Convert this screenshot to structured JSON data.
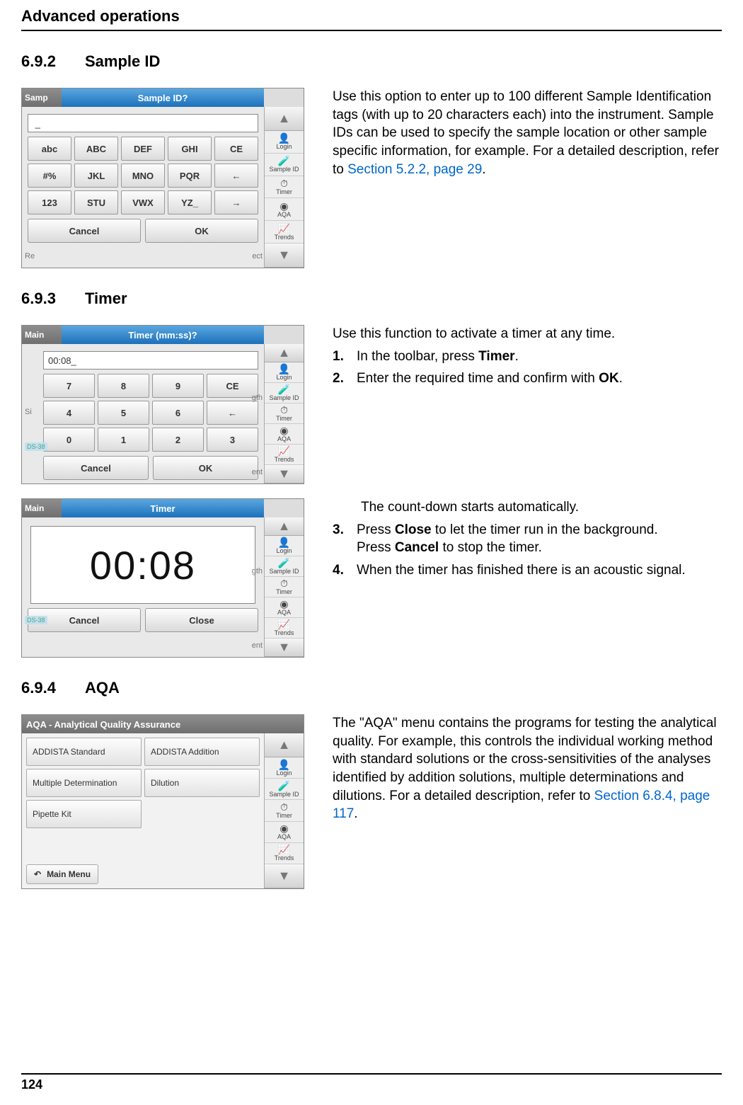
{
  "header": {
    "running_head": "Advanced operations"
  },
  "sections": {
    "s692": {
      "num": "6.9.2",
      "title": "Sample ID"
    },
    "s693": {
      "num": "6.9.3",
      "title": "Timer"
    },
    "s694": {
      "num": "6.9.4",
      "title": "AQA"
    }
  },
  "body": {
    "sample_id": {
      "para_a": "Use this option to enter up to 100 different Sample Identification tags (with up to 20 characters each) into the instrument. Sample IDs can be used to specify  the sample location or other sample specific information, for example. For a detailed description, refer to ",
      "link": "Section 5.2.2, page 29",
      "para_b": "."
    },
    "timer_intro": {
      "lead": "Use this function to activate a timer at any time.",
      "step1_pre": "In the toolbar, press ",
      "step1_bold": "Timer",
      "step1_post": ".",
      "step2_pre": "Enter the required time and confirm with ",
      "step2_bold": "OK",
      "step2_post": "."
    },
    "timer_run": {
      "lead": "The count-down starts automatically.",
      "step3_pre": "Press ",
      "step3_bold1": "Close",
      "step3_mid": " to let the timer run in the background.",
      "step3_line2_pre": "Press ",
      "step3_bold2": "Cancel",
      "step3_line2_post": " to stop the timer.",
      "step4": "When the timer has finished there is an acoustic signal."
    },
    "aqa": {
      "para_a": "The \"AQA\" menu contains the programs for testing the analytical quality. For example, this controls the individual working method with standard solutions or the cross-sensitivities of the analyses identified by addition solutions, multiple determinations and dilutions. For a detailed description, refer to ",
      "link": "Section 6.8.4, page 117",
      "para_b": "."
    }
  },
  "screens": {
    "rail": {
      "login": "Login",
      "sample_id": "Sample ID",
      "timer": "Timer",
      "aqa": "AQA",
      "trends": "Trends"
    },
    "sample_id": {
      "bg_title_frag": "Samp",
      "dialog_title": "Sample ID?",
      "keys": [
        "abc",
        "ABC",
        "DEF",
        "GHI",
        "CE",
        "#%",
        "JKL",
        "MNO",
        "PQR",
        "←",
        "123",
        "STU",
        "VWX",
        "YZ_",
        "→"
      ],
      "cancel": "Cancel",
      "ok": "OK",
      "bg_left": "Re",
      "bg_right": "ect"
    },
    "timer_entry": {
      "bg_title_frag": "Main",
      "dialog_title": "Timer (mm:ss)?",
      "value": "00:08_",
      "keys": [
        "7",
        "8",
        "9",
        "CE",
        "4",
        "5",
        "6",
        "←",
        "0",
        "1",
        "2",
        "3"
      ],
      "cancel": "Cancel",
      "ok": "OK",
      "bg_right1": "gth",
      "bg_right2": "ent",
      "bg_left": "Si",
      "ds_tag": "DS-38"
    },
    "timer_run": {
      "bg_title_frag": "Main",
      "dialog_title": "Timer",
      "display": "00:08",
      "cancel": "Cancel",
      "close": "Close",
      "bg_right1": "gth",
      "bg_right2": "ent",
      "ds_tag": "DS-38"
    },
    "aqa": {
      "titlebar": "AQA - Analytical Quality Assurance",
      "tiles": [
        "ADDISTA Standard",
        "ADDISTA Addition",
        "Multiple Determination",
        "Dilution",
        "Pipette Kit"
      ],
      "main_menu": "Main Menu"
    }
  },
  "step_numbers": {
    "n1": "1.",
    "n2": "2.",
    "n3": "3.",
    "n4": "4."
  },
  "footer": {
    "page": "124"
  }
}
